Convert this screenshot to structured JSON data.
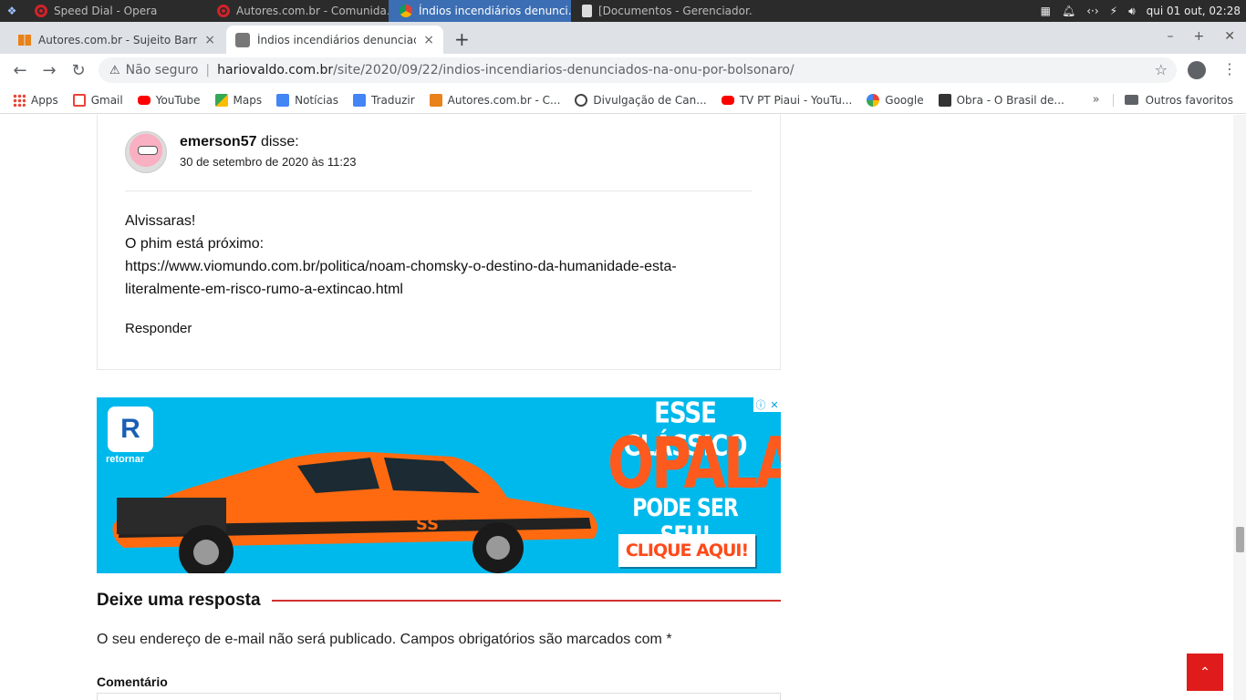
{
  "taskbar": {
    "tasks": [
      {
        "label": "Speed Dial - Opera"
      },
      {
        "label": "Autores.com.br - Comunida..."
      },
      {
        "label": "Índios incendiários denunci..."
      },
      {
        "label": "[Documentos - Gerenciador..."
      }
    ],
    "clock": "qui 01 out, 02:28"
  },
  "tabs": [
    {
      "label": "Autores.com.br - Sujeito Barroc",
      "close": "×"
    },
    {
      "label": "Índios incendiários denunciado",
      "close": "×"
    }
  ],
  "toolbar": {
    "security_label": "Não seguro",
    "url_host": "hariovaldo.com.br",
    "url_path": "/site/2020/09/22/indios-incendiarios-denunciados-na-onu-por-bolsonaro/"
  },
  "bookmarks": {
    "items": [
      {
        "label": "Apps",
        "icon": "apps-icon"
      },
      {
        "label": "Gmail",
        "icon": "gmail-icon"
      },
      {
        "label": "YouTube",
        "icon": "youtube-icon"
      },
      {
        "label": "Maps",
        "icon": "maps-icon"
      },
      {
        "label": "Notícias",
        "icon": "news-icon"
      },
      {
        "label": "Traduzir",
        "icon": "translate-icon"
      },
      {
        "label": "Autores.com.br - C...",
        "icon": "book-icon"
      },
      {
        "label": "Divulgação de Can...",
        "icon": "globe-icon"
      },
      {
        "label": "TV PT Piaui - YouTu...",
        "icon": "youtube-icon"
      },
      {
        "label": "Google",
        "icon": "google-icon"
      },
      {
        "label": "Obra - O Brasil de...",
        "icon": "obra-icon"
      }
    ],
    "more": "»",
    "other_label": "Outros favoritos"
  },
  "comment": {
    "author": "emerson57",
    "said": "disse:",
    "date": "30 de setembro de 2020 às 11:23",
    "line1": "Alvissaras!",
    "line2": "O phim está próximo:",
    "link": "https://www.viomundo.com.br/politica/noam-chomsky-o-destino-da-humanidade-esta-literalmente-em-risco-rumo-a-extincao.html",
    "reply_label": "Responder"
  },
  "ad": {
    "brand": "retornar",
    "line1": "ESSE CLÁSSICO",
    "line2": "OPALA",
    "line3": "PODE SER SEU!",
    "cta": "CLIQUE AQUI!",
    "colors": {
      "background": "#00b9ec",
      "accent": "#ff5a1e"
    }
  },
  "reply_form": {
    "title": "Deixe uma resposta",
    "notice": "O seu endereço de e-mail não será publicado. Campos obrigatórios são marcados com *",
    "comment_label": "Comentário"
  },
  "colors": {
    "accent": "#d32f2f",
    "to_top": "#e01b1b"
  }
}
